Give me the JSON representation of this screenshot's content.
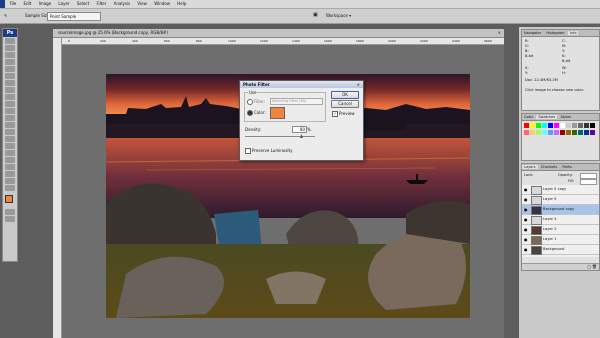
{
  "menu": [
    "File",
    "Edit",
    "Image",
    "Layer",
    "Select",
    "Filter",
    "Analysis",
    "View",
    "Window",
    "Help"
  ],
  "options_bar": {
    "sample_size_label": "Sample Size:",
    "sample_size_value": "Point Sample",
    "workspace_label": "Workspace ▾"
  },
  "tools": {
    "app_badge": "Ps"
  },
  "document": {
    "tab_title": "sourceimage.jpg @ 25.6% (Background copy, RGB/8#)",
    "ruler_ticks": [
      "0",
      "200",
      "400",
      "600",
      "800",
      "1000",
      "1200",
      "1400",
      "1600",
      "1800",
      "2000",
      "2200",
      "2400",
      "2600"
    ]
  },
  "photo_filter": {
    "title": "Photo Filter",
    "use_label": "Use",
    "filter_label": "Filter:",
    "filter_value": "Warming Filter (85)",
    "color_label": "Color:",
    "color_value": "#f08440",
    "density_label": "Density:",
    "density_value": "80",
    "density_unit": "%",
    "density_fraction": 0.8,
    "preserve_label": "Preserve Luminosity",
    "ok_label": "OK",
    "cancel_label": "Cancel",
    "preview_label": "Preview",
    "preview_checked": true
  },
  "info_panel": {
    "tabs": [
      "Navigator",
      "Histogram",
      "Info"
    ],
    "active_tab": "Info",
    "rgb_labels": [
      "R:",
      "G:",
      "B:"
    ],
    "cmyk_labels": [
      "C:",
      "M:",
      "Y:",
      "K:"
    ],
    "bit_depth_left": "8-bit",
    "bit_depth_right": "8-bit",
    "xy_labels": [
      "X:",
      "Y:"
    ],
    "wh_labels": [
      "W:",
      "H:"
    ],
    "doc_size": "Doc: 22.4M/63.2M",
    "hint": "Click image to choose new color."
  },
  "swatches_panel": {
    "tabs": [
      "Color",
      "Swatches",
      "Styles"
    ],
    "active_tab": "Swatches",
    "colors": [
      "#ff0000",
      "#ffff00",
      "#00ff00",
      "#00ffff",
      "#0000ff",
      "#ff00ff",
      "#ffffff",
      "#cccccc",
      "#999999",
      "#666666",
      "#333333",
      "#000000",
      "#ff6666",
      "#ffcc66",
      "#99ff66",
      "#66ffff",
      "#6699ff",
      "#cc66ff",
      "#990000",
      "#996600",
      "#336600",
      "#006666",
      "#003399",
      "#660099"
    ]
  },
  "layers_panel": {
    "tabs": [
      "Layers",
      "Channels",
      "Paths"
    ],
    "active_tab": "Layers",
    "blend_mode": "Lock:",
    "opacity_label": "Opacity:",
    "opacity_value": "",
    "fill_label": "Fill:",
    "fill_value": "",
    "layers": [
      {
        "name": "Layer 5 copy",
        "visible": true,
        "selected": false,
        "thumb": "#d8d8d8"
      },
      {
        "name": "Layer 5",
        "visible": true,
        "selected": false,
        "thumb": "#d8d8d8"
      },
      {
        "name": "Background copy",
        "visible": true,
        "selected": true,
        "thumb": "#3a3040"
      },
      {
        "name": "Layer 3",
        "visible": true,
        "selected": false,
        "thumb": "#d8d8d8"
      },
      {
        "name": "Layer 2",
        "visible": true,
        "selected": false,
        "thumb": "#5a3a30"
      },
      {
        "name": "Layer 1",
        "visible": true,
        "selected": false,
        "thumb": "#7a6a55"
      },
      {
        "name": "Background",
        "visible": true,
        "selected": false,
        "thumb": "#4a4438"
      }
    ]
  }
}
